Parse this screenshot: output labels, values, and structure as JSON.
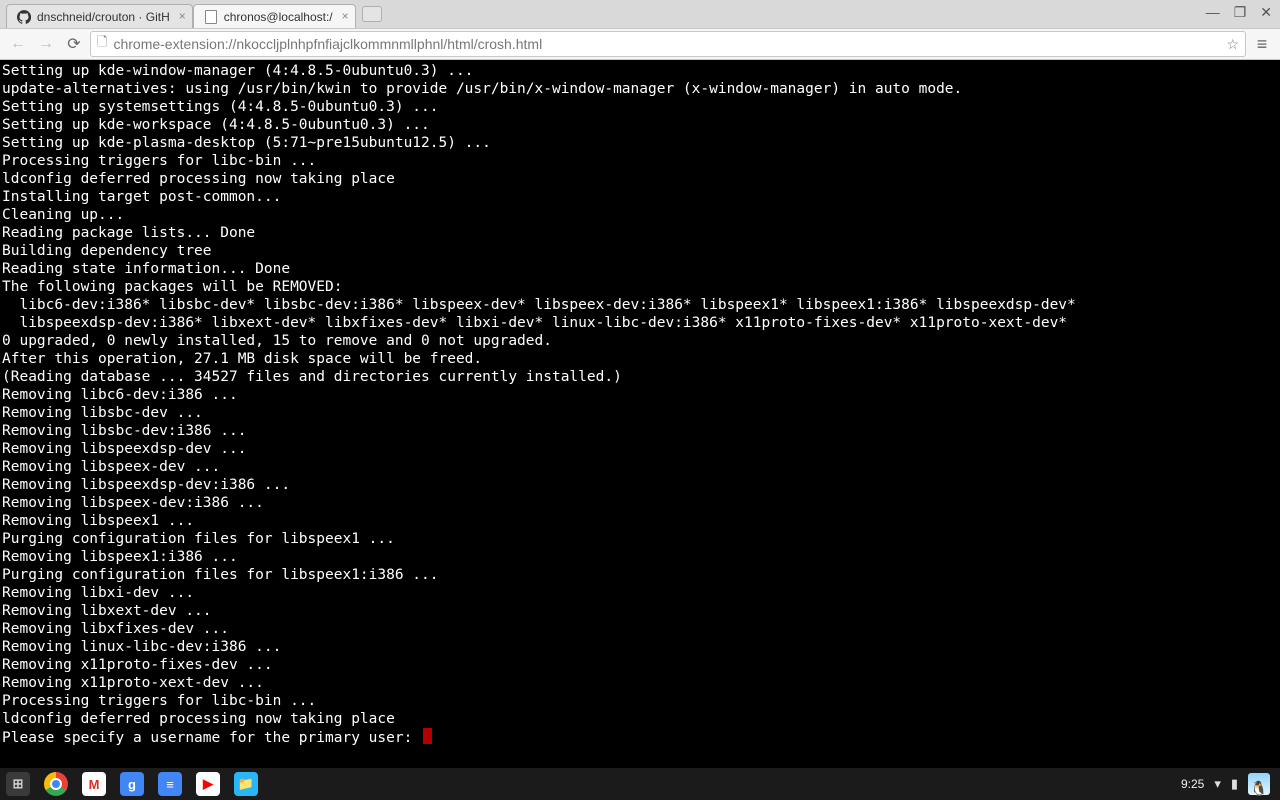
{
  "window": {
    "controls": {
      "minimize": "—",
      "maximize": "❐",
      "close": "✕"
    }
  },
  "tabs": [
    {
      "title": "dnschneid/crouton · GitH",
      "active": false,
      "favicon": "github"
    },
    {
      "title": "chronos@localhost:/",
      "active": true,
      "favicon": "blank"
    }
  ],
  "toolbar": {
    "url": "chrome-extension://nkoccljplnhpfnfiajclkommnmllphnl/html/crosh.html"
  },
  "terminal": {
    "lines": [
      "Setting up kde-window-manager (4:4.8.5-0ubuntu0.3) ...",
      "update-alternatives: using /usr/bin/kwin to provide /usr/bin/x-window-manager (x-window-manager) in auto mode.",
      "Setting up systemsettings (4:4.8.5-0ubuntu0.3) ...",
      "Setting up kde-workspace (4:4.8.5-0ubuntu0.3) ...",
      "Setting up kde-plasma-desktop (5:71~pre15ubuntu12.5) ...",
      "Processing triggers for libc-bin ...",
      "ldconfig deferred processing now taking place",
      "Installing target post-common...",
      "Cleaning up...",
      "Reading package lists... Done",
      "Building dependency tree       ",
      "Reading state information... Done",
      "The following packages will be REMOVED:",
      "  libc6-dev:i386* libsbc-dev* libsbc-dev:i386* libspeex-dev* libspeex-dev:i386* libspeex1* libspeex1:i386* libspeexdsp-dev*",
      "  libspeexdsp-dev:i386* libxext-dev* libxfixes-dev* libxi-dev* linux-libc-dev:i386* x11proto-fixes-dev* x11proto-xext-dev*",
      "0 upgraded, 0 newly installed, 15 to remove and 0 not upgraded.",
      "After this operation, 27.1 MB disk space will be freed.",
      "(Reading database ... 34527 files and directories currently installed.)",
      "Removing libc6-dev:i386 ...",
      "Removing libsbc-dev ...",
      "Removing libsbc-dev:i386 ...",
      "Removing libspeexdsp-dev ...",
      "Removing libspeex-dev ...",
      "Removing libspeexdsp-dev:i386 ...",
      "Removing libspeex-dev:i386 ...",
      "Removing libspeex1 ...",
      "Purging configuration files for libspeex1 ...",
      "Removing libspeex1:i386 ...",
      "Purging configuration files for libspeex1:i386 ...",
      "Removing libxi-dev ...",
      "Removing libxext-dev ...",
      "Removing libxfixes-dev ...",
      "Removing linux-libc-dev:i386 ...",
      "Removing x11proto-fixes-dev ...",
      "Removing x11proto-xext-dev ...",
      "Processing triggers for libc-bin ...",
      "ldconfig deferred processing now taking place"
    ],
    "prompt": "Please specify a username for the primary user: "
  },
  "shelf": {
    "time": "9:25",
    "apps": [
      {
        "name": "launcher",
        "glyph": "⊞"
      },
      {
        "name": "chrome",
        "glyph": ""
      },
      {
        "name": "gmail",
        "glyph": "M"
      },
      {
        "name": "google-search",
        "glyph": "g"
      },
      {
        "name": "google-docs",
        "glyph": "≡"
      },
      {
        "name": "youtube",
        "glyph": "▶"
      },
      {
        "name": "files",
        "glyph": "📁"
      }
    ]
  }
}
